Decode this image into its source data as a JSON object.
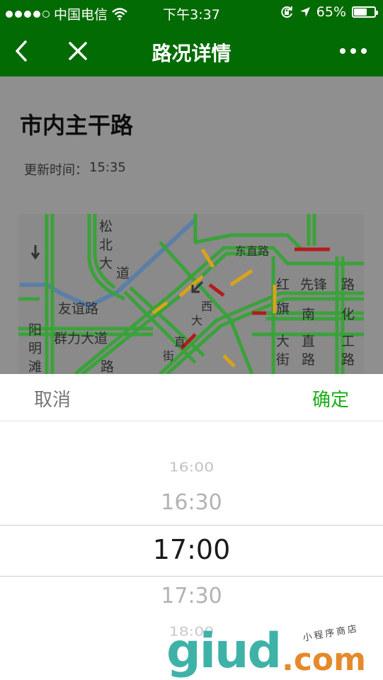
{
  "status_bar": {
    "carrier": "中国电信",
    "time": "下午3:37",
    "battery_percent": "65%",
    "battery_level": 0.65
  },
  "nav": {
    "title": "路况详情",
    "back_icon": "chevron-left-icon",
    "close_icon": "close-icon",
    "more_icon": "more-dots-icon"
  },
  "page": {
    "title": "市内主干路",
    "update_label": "更新时间：",
    "update_time": "15:35"
  },
  "map": {
    "labels": [
      "松",
      "北",
      "大",
      "道",
      "东直路",
      "红",
      "先锋",
      "路",
      "友谊路",
      "西",
      "大",
      "旗",
      "南",
      "化",
      "阳",
      "明",
      "滩",
      "群力大道",
      "直",
      "街",
      "大",
      "街",
      "直",
      "路",
      "工",
      "路",
      "路"
    ],
    "colors": {
      "smooth": "#3aa23a",
      "slow": "#d9a31a",
      "jam": "#b31c1c",
      "river": "#5b7fa6"
    }
  },
  "picker": {
    "cancel_label": "取消",
    "confirm_label": "确定",
    "options": [
      "16:00",
      "16:30",
      "17:00",
      "17:30",
      "18:00"
    ],
    "selected_index": 2
  },
  "watermark": {
    "text": "giud",
    "suffix": ".com",
    "sub": "小程序商店"
  },
  "colors": {
    "brand_green": "#036b03",
    "confirm_green": "#1aad19",
    "mask_gray": "#8f8f8f"
  }
}
